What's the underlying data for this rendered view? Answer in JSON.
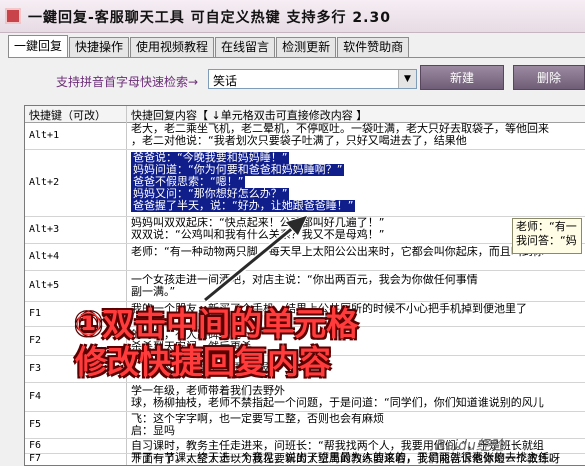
{
  "window": {
    "title": "一鍵回复-客服聊天工具  可自定义热键  支持多行  2.30"
  },
  "tabs": [
    "一鍵回复",
    "快捷操作",
    "使用视频教程",
    "在线留言",
    "检测更新",
    "软件赞助商"
  ],
  "search": {
    "label": "支持拼音首字母快速检索→",
    "value": "笑话"
  },
  "buttons": {
    "new": "新建",
    "delete": "删除"
  },
  "grid": {
    "headers": [
      "快捷键（可改）",
      "快捷回复内容【 ↓单元格双击可直接修改内容 】"
    ],
    "rows": [
      {
        "key": "Alt+1",
        "lines": [
          "老大，老二乘坐飞机，老二晕机，不停呕吐。一袋吐满，老大只好去取袋子，等他回来",
          "，老二对他说：“我者划次只要袋子吐满了，只好又喝进去了，结果他"
        ]
      },
      {
        "key": "Alt+2",
        "lines": [
          "爸爸说：“今晚我要和妈妈睡！”",
          "妈妈问道：“你为何要和爸爸和妈妈睡啊？”",
          "爸爸不假思索：“嗯！”",
          "妈妈又问：“那你想好怎么办？”",
          "爸爸握了半天，说：“好办，让她跟爸爸睡！”"
        ]
      },
      {
        "key": "Alt+3",
        "lines": [
          "妈妈叫双双起床：“快点起来！公鸡都叫好几遍了！”",
          "双双说：“公鸡叫和我有什么关系？我又不是母鸡！”"
        ]
      },
      {
        "key": "Alt+4",
        "lines": [
          "老师：“有一种动物两只脚，每天早上太阳公公出来时，它都会叫你起床，而且叫到你"
        ]
      },
      {
        "key": "Alt+5",
        "lines": [
          "一个女孩走进一间酒吧，对店主说：“你出两百元，我会为你做任何事情",
          "副一满。”"
        ]
      },
      {
        "key": "F1",
        "lines": [
          "我的一个朋友，新买了个手机。结果上公共厕所的时候不小心把手机掉到便池里了"
        ]
      },
      {
        "key": "F2",
        "lines": [
          "                                    的时候，有人路碑打电",
          "                                    杀杀到天安门，然后再杀"
        ]
      },
      {
        "key": "F3",
        "lines": [
          "                                   ，教练又大声说了一便：“报数"
        ]
      },
      {
        "key": "F4",
        "lines": [
          "                               学一年级，老师带着我们去野外",
          "球，杨柳抽枝，老师不禁指起一个问题，于是问道：“同学们，你们知道谁说别的风儿"
        ]
      },
      {
        "key": "F5",
        "lines": [
          "飞：这个字字啊，也一定要写工整，否则也会有麻烦",
          "启：显吗"
        ]
      },
      {
        "key": "F6",
        "lines": [
          "自习课时，教务主任走进来，问班长：“帮我找两个人，我要用他们。”，于是班长就组",
          "开了一节课，终于选一个意见，说出了班里最为人的这的，于是两就很素张的去找主任。"
        ]
      },
      {
        "key": "F7",
        "lines": [
          "下面有了。太空人士以为我在要新的大空局的教练要来看，我们能告诉他你是一个教练呀"
        ]
      }
    ]
  },
  "tooltip": {
    "lines": [
      "老师：“有一",
      "我问答：“妈"
    ]
  },
  "annotation": {
    "lines": [
      "①双击中间的单元格",
      "修改快捷回复内容"
    ]
  },
  "watermark": "Baidu经验",
  "colors": {
    "highlight": "#0f1e8a",
    "annotation": "#ff3b3b",
    "button": "#6f5d77"
  }
}
